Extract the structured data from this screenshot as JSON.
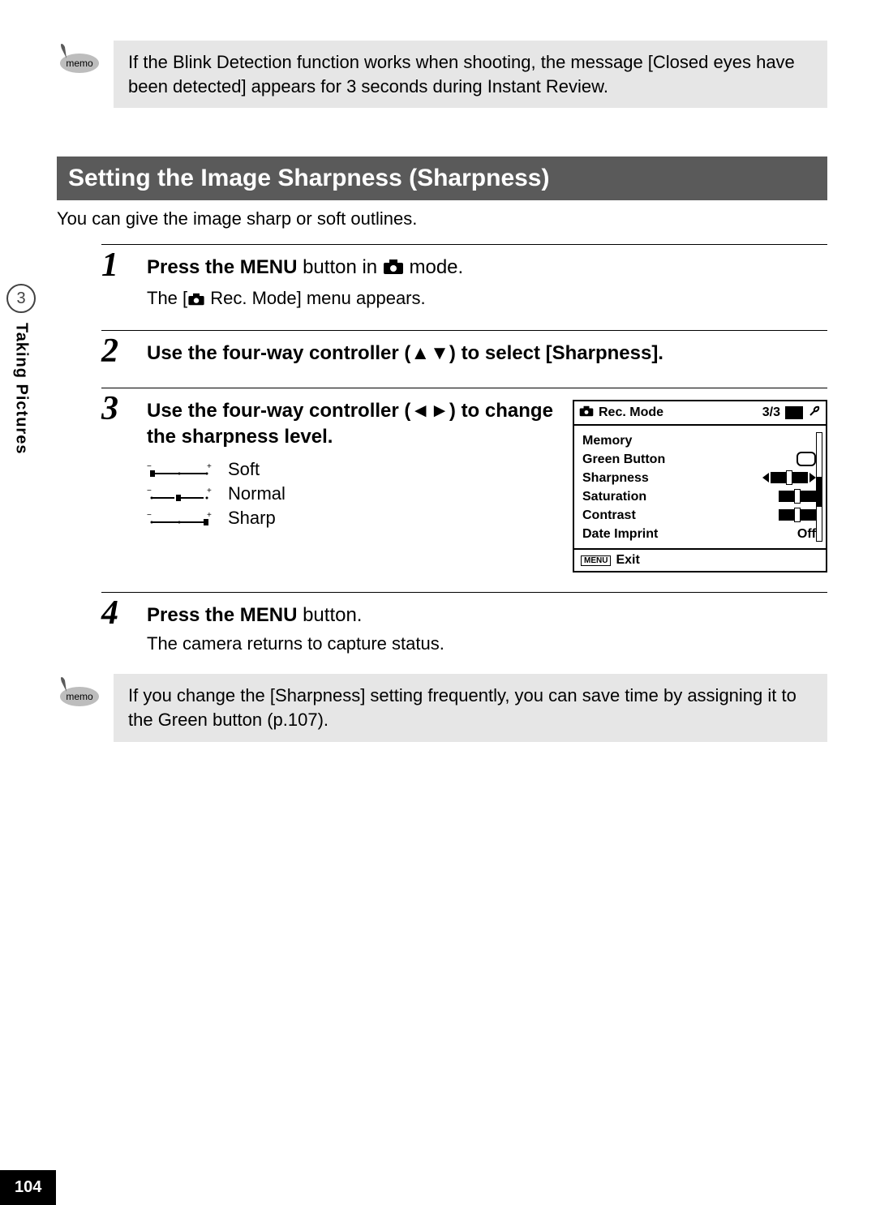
{
  "memo1": "If the Blink Detection function works when shooting, the message [Closed eyes have been detected] appears for 3 seconds during Instant Review.",
  "section_title": "Setting the Image Sharpness (Sharpness)",
  "intro": "You can give the image sharp or soft outlines.",
  "side": {
    "chapter_num": "3",
    "chapter_label": "Taking Pictures"
  },
  "steps": {
    "s1": {
      "num": "1",
      "title_a": "Press the ",
      "title_b": "MENU",
      "title_c": " button in ",
      "title_d": " mode.",
      "desc_a": "The [",
      "desc_b": " Rec. Mode] menu appears."
    },
    "s2": {
      "num": "2",
      "title_a": "Use the four-way controller (",
      "title_b": ") to select [Sharpness]."
    },
    "s3": {
      "num": "3",
      "title_a": "Use the four-way controller (",
      "title_b": ") to change the sharpness level.",
      "levels": {
        "soft": "Soft",
        "normal": "Normal",
        "sharp": "Sharp"
      }
    },
    "s4": {
      "num": "4",
      "title_a": "Press the ",
      "title_b": "MENU",
      "title_c": " button.",
      "desc": "The camera returns to capture status."
    }
  },
  "lcd": {
    "header_title": "Rec. Mode",
    "header_page": "3/3",
    "rows": {
      "memory": "Memory",
      "green": "Green Button",
      "sharpness": "Sharpness",
      "saturation": "Saturation",
      "contrast": "Contrast",
      "date_imprint": "Date Imprint",
      "date_imprint_val": "Off"
    },
    "footer_menu": "MENU",
    "footer_exit": "Exit"
  },
  "memo2": "If you change the [Sharpness] setting frequently, you can save time by assigning it to the Green button (p.107).",
  "page_number": "104"
}
